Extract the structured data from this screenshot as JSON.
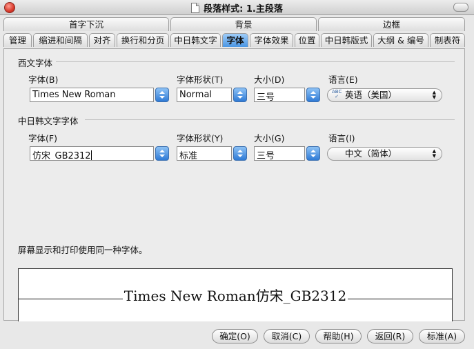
{
  "window": {
    "title": "段落样式: 1.主段落"
  },
  "tabs": {
    "row1": [
      "首字下沉",
      "背景",
      "边框"
    ],
    "row2": [
      "管理",
      "缩进和间隔",
      "对齐",
      "换行和分页",
      "中日韩文字",
      "字体",
      "字体效果",
      "位置",
      "中日韩版式",
      "大纲 & 编号",
      "制表符"
    ],
    "active": "字体"
  },
  "western": {
    "section": "西文字体",
    "font_label": "字体(B)",
    "font_value": "Times New Roman",
    "style_label": "字体形状(T)",
    "style_value": "Normal",
    "size_label": "大小(D)",
    "size_value": "三号",
    "lang_label": "语言(E)",
    "lang_value": "英语（美国）"
  },
  "cjk": {
    "section": "中日韩文字字体",
    "font_label": "字体(F)",
    "font_value": "仿宋_GB2312",
    "style_label": "字体形状(Y)",
    "style_value": "标准",
    "size_label": "大小(G)",
    "size_value": "三号",
    "lang_label": "语言(I)",
    "lang_value": "中文（简体）"
  },
  "note": "屏幕显示和打印使用同一种字体。",
  "preview": {
    "text": "Times New Roman仿宋_GB2312"
  },
  "buttons": {
    "ok": "确定(O)",
    "cancel": "取消(C)",
    "help": "帮助(H)",
    "reset": "返回(R)",
    "standard": "标准(A)"
  }
}
